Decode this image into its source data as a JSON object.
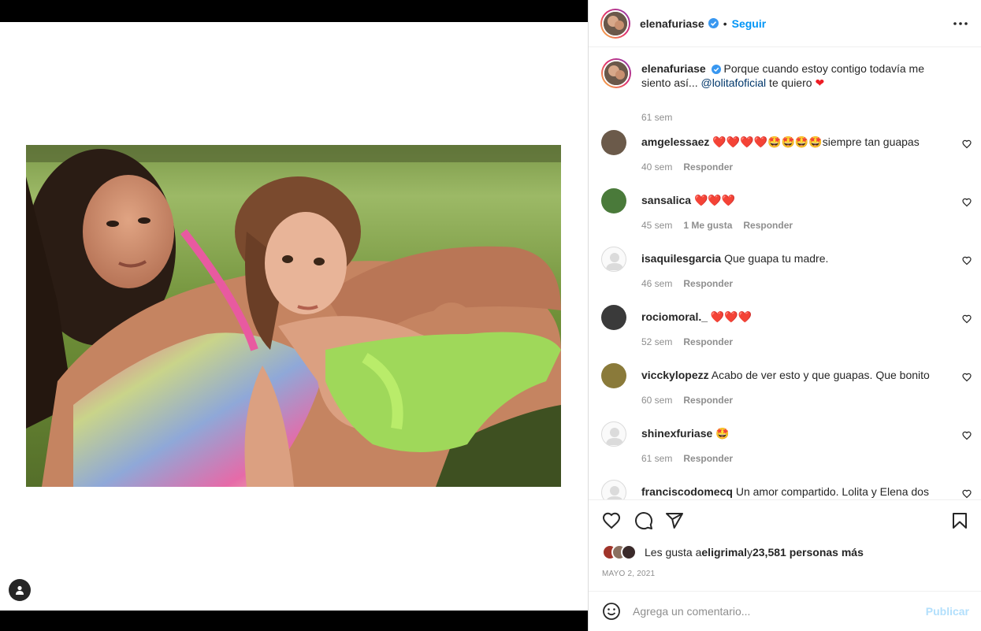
{
  "post": {
    "author": "elenafuriase",
    "follow_label": "Seguir",
    "caption_prefix": "Porque cuando estoy contigo todavía me siento así... ",
    "caption_mention": "@lolitafoficial",
    "caption_suffix": " te quiero ",
    "caption_time": "61 sem"
  },
  "comments": [
    {
      "user": "amgelessaez",
      "text": "siempre tan guapas",
      "emoji": "❤️❤️❤️❤️🤩🤩🤩🤩",
      "time": "40 sem",
      "likes": "",
      "reply": "Responder",
      "avatar_color": "#6b5a4a"
    },
    {
      "user": "sansalica",
      "text": "",
      "emoji": "❤️❤️❤️",
      "time": "45 sem",
      "likes": "1 Me gusta",
      "reply": "Responder",
      "avatar_color": "#4a7a3a"
    },
    {
      "user": "isaquilesgarcia",
      "text": "Que guapa tu madre.",
      "emoji": "",
      "time": "46 sem",
      "likes": "",
      "reply": "Responder",
      "avatar_color": "#dbdbdb"
    },
    {
      "user": "rociomoral._",
      "text": "",
      "emoji": "❤️❤️❤️",
      "time": "52 sem",
      "likes": "",
      "reply": "Responder",
      "avatar_color": "#3a3a3a"
    },
    {
      "user": "vicckylopezz",
      "text": "Acabo de ver esto y que guapas. Que bonito",
      "emoji": "",
      "time": "60 sem",
      "likes": "",
      "reply": "Responder",
      "avatar_color": "#8a7a3a"
    },
    {
      "user": "shinexfuriase",
      "text": "",
      "emoji": "🤩",
      "time": "61 sem",
      "likes": "",
      "reply": "Responder",
      "avatar_color": "#dbdbdb"
    },
    {
      "user": "franciscodomecq",
      "text": "Un amor compartido. Lolita y Elena dos",
      "emoji": "",
      "time": "",
      "likes": "",
      "reply": "",
      "avatar_color": "#dbdbdb"
    }
  ],
  "likes_bar": {
    "prefix": "Les gusta a ",
    "user": "eligrimal",
    "middle": " y ",
    "count": "23,581 personas más"
  },
  "date": "MAYO 2, 2021",
  "composer": {
    "placeholder": "Agrega un comentario...",
    "publish": "Publicar"
  },
  "colors": {
    "link": "#0095f6",
    "mention": "#00376b",
    "muted": "#8e8e8e",
    "heart_red": "#ed4956",
    "publish_disabled": "#b2dffc"
  }
}
